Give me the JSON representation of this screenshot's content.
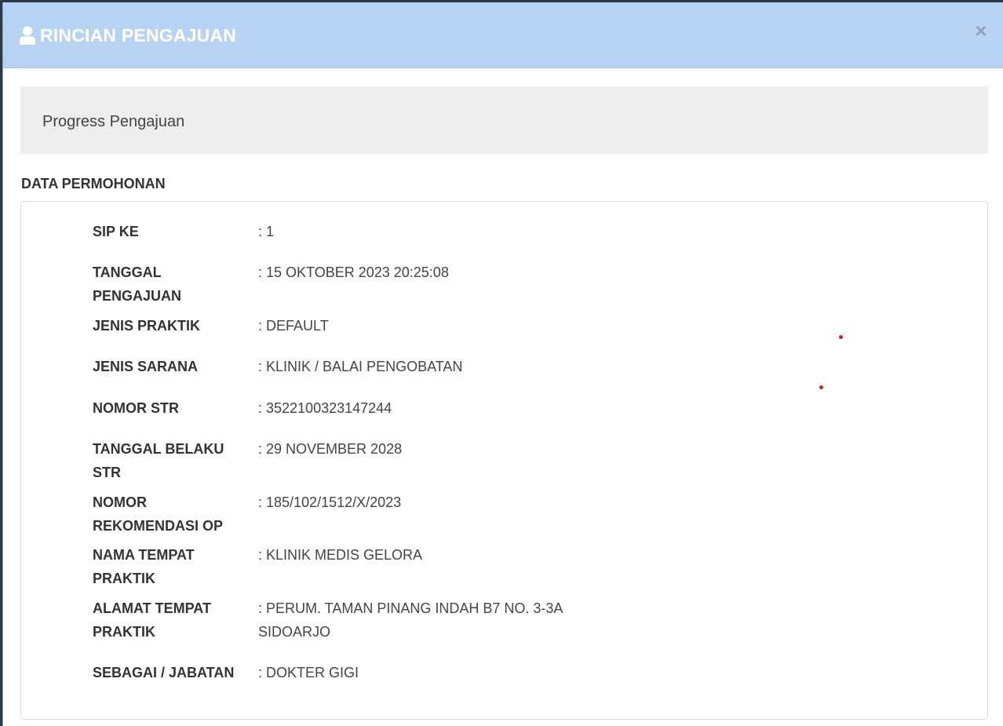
{
  "header": {
    "icon": "user-icon",
    "title": "RINCIAN PENGAJUAN",
    "close_label": "×"
  },
  "progress": {
    "label": "Progress Pengajuan"
  },
  "section": {
    "title": "DATA PERMOHONAN"
  },
  "fields": [
    {
      "label": "SIP KE",
      "value": ": 1"
    },
    {
      "label": "TANGGAL PENGAJUAN",
      "value": ": 15 OKTOBER 2023 20:25:08"
    },
    {
      "label": "JENIS PRAKTIK",
      "value": ": DEFAULT"
    },
    {
      "label": "JENIS SARANA",
      "value": ": KLINIK / BALAI PENGOBATAN"
    },
    {
      "label": "NOMOR STR",
      "value": ": 3522100323147244"
    },
    {
      "label": "TANGGAL BELAKU STR",
      "value": ": 29 NOVEMBER 2028"
    },
    {
      "label": "NOMOR REKOMENDASI OP",
      "value": ": 185/102/1512/X/2023"
    },
    {
      "label": "NAMA TEMPAT PRAKTIK",
      "value": ": KLINIK MEDIS GELORA"
    },
    {
      "label": "ALAMAT TEMPAT PRAKTIK",
      "value": ": PERUM. TAMAN PINANG INDAH B7 NO. 3-3A SIDOARJO"
    },
    {
      "label": "SEBAGAI / JABATAN",
      "value": ": DOKTER GIGI"
    }
  ],
  "colors": {
    "header_bg": "#b8d3f1",
    "panel_bg": "#eeeeee",
    "marker": "#d0202a"
  }
}
